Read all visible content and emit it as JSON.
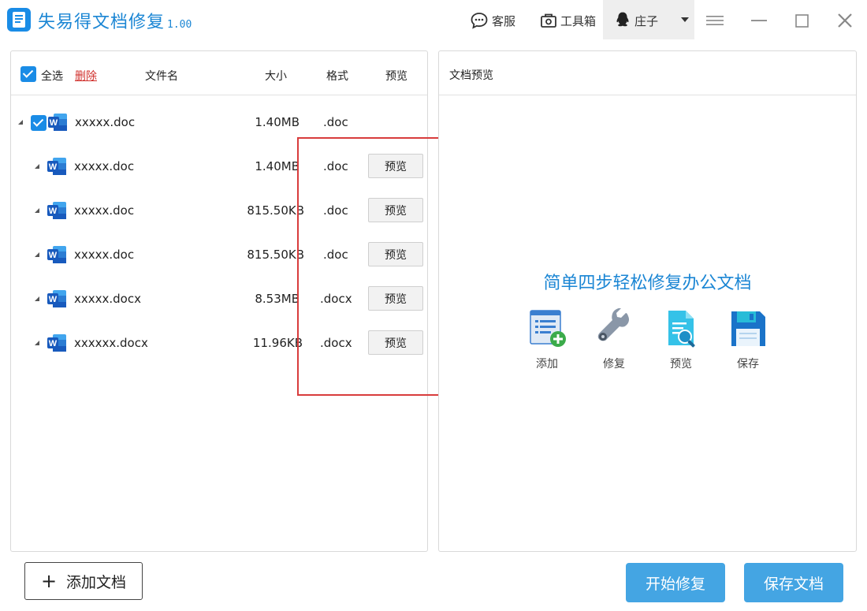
{
  "app": {
    "title": "失易得文档修复",
    "version": "1.00"
  },
  "titlebar": {
    "service_label": "客服",
    "toolbox_label": "工具箱",
    "username": "庄子"
  },
  "file_list": {
    "select_all_label": "全选",
    "delete_label": "删除",
    "columns": {
      "name": "文件名",
      "size": "大小",
      "format": "格式",
      "preview": "预览"
    },
    "parent": {
      "name": "xxxxx.doc",
      "size": "1.40MB",
      "ext": ".doc"
    },
    "children": [
      {
        "name": "xxxxx.doc",
        "size": "1.40MB",
        "ext": ".doc",
        "preview_label": "预览"
      },
      {
        "name": "xxxxx.doc",
        "size": "815.50KB",
        "ext": ".doc",
        "preview_label": "预览"
      },
      {
        "name": "xxxxx.doc",
        "size": "815.50KB",
        "ext": ".doc",
        "preview_label": "预览"
      },
      {
        "name": "xxxxx.docx",
        "size": "8.53MB",
        "ext": ".docx",
        "preview_label": "预览"
      },
      {
        "name": "xxxxxx.docx",
        "size": "11.96KB",
        "ext": ".docx",
        "preview_label": "预览"
      }
    ]
  },
  "preview_panel": {
    "header": "文档预览",
    "slogan": "简单四步轻松修复办公文档",
    "steps": [
      {
        "label": "添加",
        "icon": "add-document-icon"
      },
      {
        "label": "修复",
        "icon": "wrench-icon"
      },
      {
        "label": "预览",
        "icon": "preview-document-icon"
      },
      {
        "label": "保存",
        "icon": "floppy-disk-icon"
      }
    ]
  },
  "footer": {
    "add_label": "添加文档",
    "start_label": "开始修复",
    "save_label": "保存文档"
  },
  "colors": {
    "accent": "#1b86d4",
    "button_blue": "#44a5e3",
    "highlight_red": "#d83c3c",
    "delete_red": "#d0302c"
  }
}
